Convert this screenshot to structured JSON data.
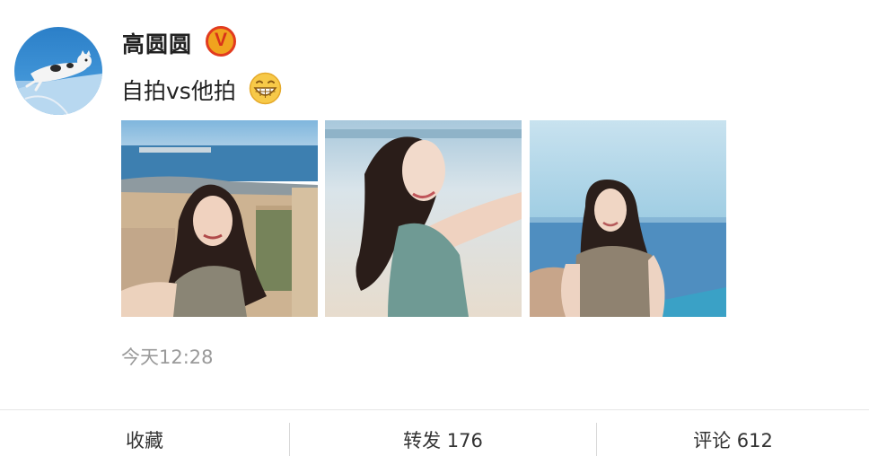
{
  "post": {
    "author": "高圆圆",
    "verified_mark": "V",
    "text": "自拍vs他拍",
    "emoji": "grinning-emoji",
    "photos": [
      {
        "name": "selfie-photo"
      },
      {
        "name": "seaside-photo"
      },
      {
        "name": "portrait-photo"
      }
    ],
    "timestamp": "今天12:28"
  },
  "actions": {
    "favorite_label": "收藏",
    "repost_label": "转发 176",
    "comment_label": "评论 612"
  },
  "colors": {
    "verified_badge": "#f0a31e",
    "verified_border": "#e23b1e",
    "timestamp": "#9a9a9a"
  }
}
